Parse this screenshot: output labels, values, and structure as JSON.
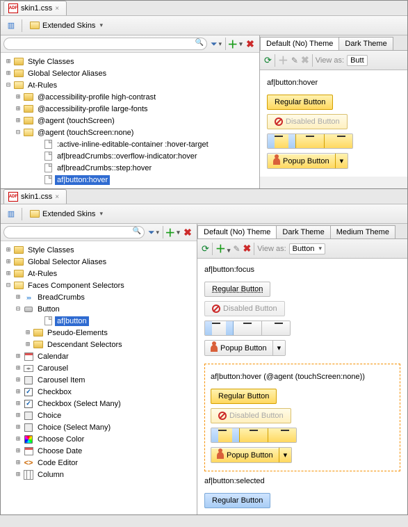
{
  "top": {
    "file_tab": "skin1.css",
    "toolbar_dropdown": "Extended Skins",
    "tree": {
      "n0": "Style Classes",
      "n1": "Global Selector Aliases",
      "n2": "At-Rules",
      "n3": "@accessibility-profile high-contrast",
      "n4": "@accessibility-profile large-fonts",
      "n5": "@agent (touchScreen)",
      "n6": "@agent (touchScreen:none)",
      "n7": ":active-inline-editable-container :hover-target",
      "n8": "af|breadCrumbs::overflow-indicator:hover",
      "n9": "af|breadCrumbs::step:hover",
      "n10": "af|button:hover"
    },
    "theme_tabs": {
      "t0": "Default (No) Theme",
      "t1": "Dark Theme"
    },
    "view_as_label": "View as:",
    "view_as_value": "Butt",
    "preview": {
      "title": "af|button:hover",
      "regular": "Regular Button",
      "disabled": "Disabled Button",
      "popup": "Popup Button"
    }
  },
  "bottom": {
    "file_tab": "skin1.css",
    "toolbar_dropdown": "Extended Skins",
    "tree": {
      "n0": "Style Classes",
      "n1": "Global Selector Aliases",
      "n2": "At-Rules",
      "n3": "Faces Component Selectors",
      "n4": "BreadCrumbs",
      "n5": "Button",
      "n6": "af|button",
      "n7": "Pseudo-Elements",
      "n8": "Descendant Selectors",
      "n9": "Calendar",
      "n10": "Carousel",
      "n11": "Carousel Item",
      "n12": "Checkbox",
      "n13": "Checkbox (Select Many)",
      "n14": "Choice",
      "n15": "Choice (Select Many)",
      "n16": "Choose Color",
      "n17": "Choose Date",
      "n18": "Code Editor",
      "n19": "Column"
    },
    "theme_tabs": {
      "t0": "Default (No) Theme",
      "t1": "Dark Theme",
      "t2": "Medium Theme"
    },
    "view_as_label": "View as:",
    "view_as_value": "Button",
    "sections": {
      "focus_title": "af|button:focus",
      "hover_title": "af|button:hover  (@agent (touchScreen:none))",
      "selected_title": "af|button:selected",
      "regular": "Regular Button",
      "disabled": "Disabled Button",
      "popup": "Popup Button"
    }
  }
}
